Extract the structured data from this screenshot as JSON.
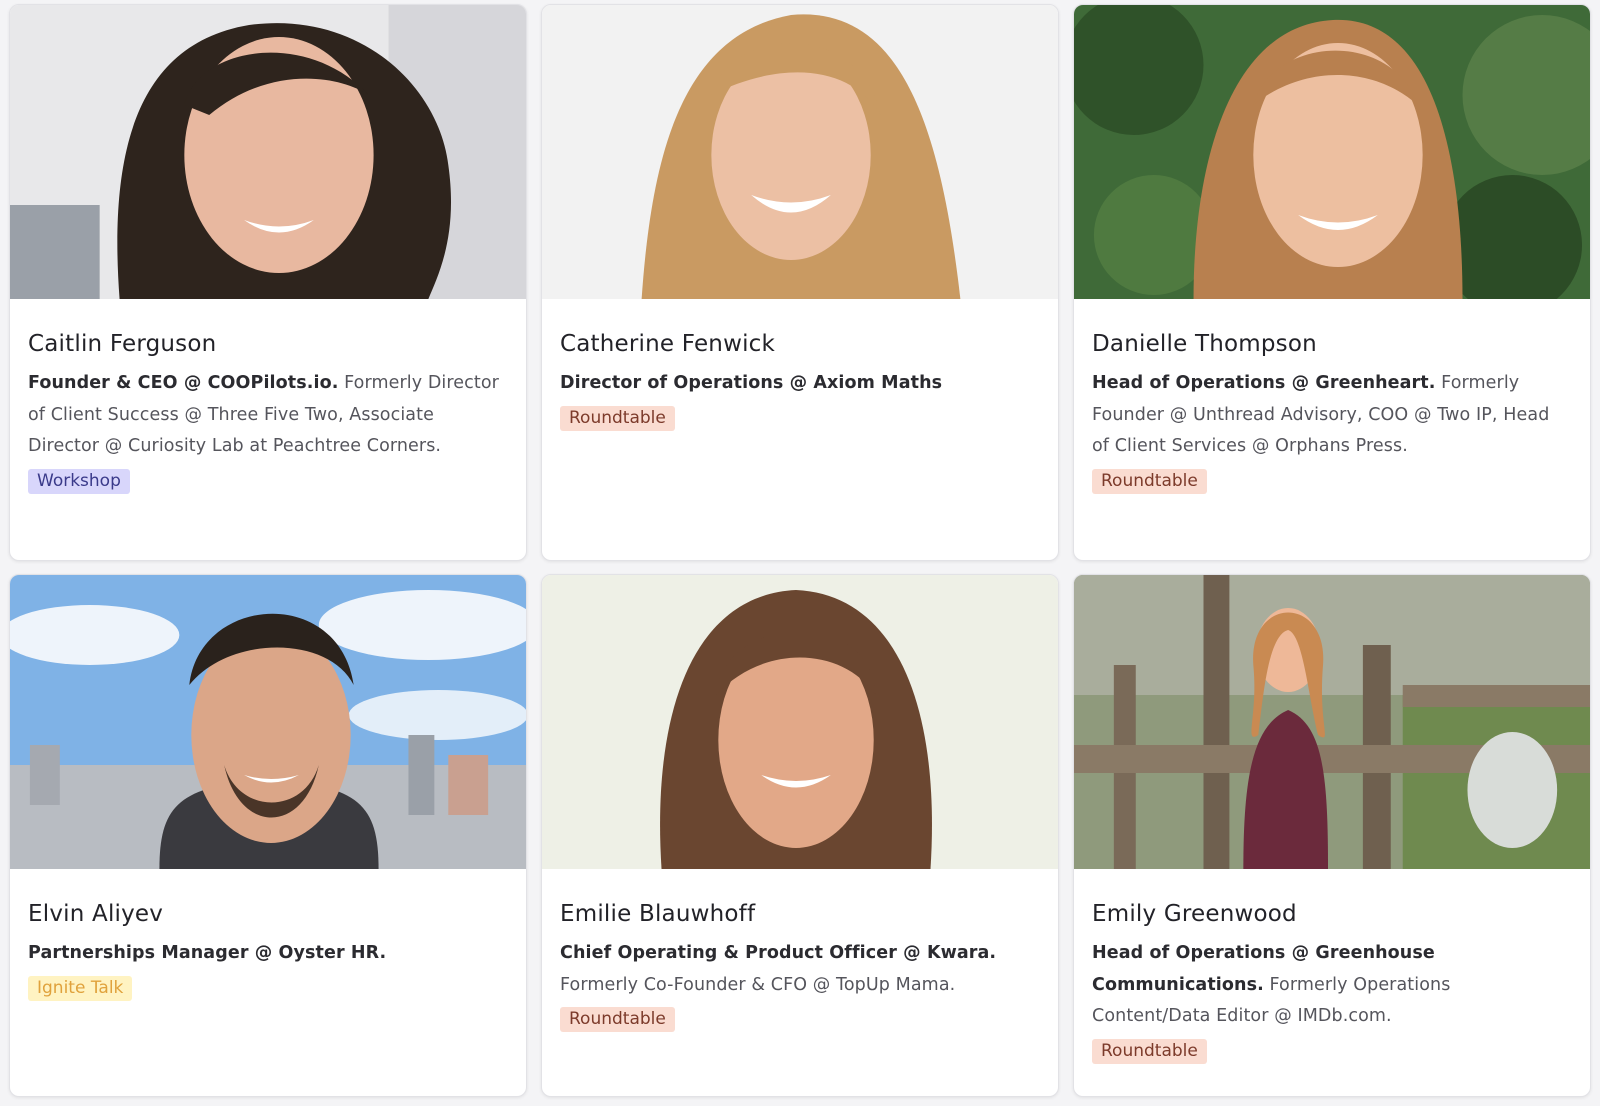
{
  "speakers": [
    {
      "name": "Caitlin Ferguson",
      "role": "Founder & CEO @ COOPilots.io.",
      "detail": " Formerly Director of Client Success @ Three Five Two, Associate Director @ Curiosity Lab at Peachtree Corners.",
      "tag": "Workshop"
    },
    {
      "name": "Catherine Fenwick",
      "role": "Director of Operations @ Axiom Maths",
      "detail": "",
      "tag": "Roundtable"
    },
    {
      "name": "Danielle Thompson",
      "role": "Head of Operations @ Greenheart.",
      "detail": " Formerly Founder @ Unthread Advisory, COO @ Two IP, Head of Client Services @ Orphans Press.",
      "tag": "Roundtable"
    },
    {
      "name": "Elvin Aliyev",
      "role": "Partnerships Manager @ Oyster HR.",
      "detail": "",
      "tag": "Ignite Talk"
    },
    {
      "name": "Emilie Blauwhoff",
      "role": "Chief Operating & Product Officer @ Kwara.",
      "detail": " Formerly Co-Founder & CFO @ TopUp Mama.",
      "tag": "Roundtable"
    },
    {
      "name": "Emily Greenwood",
      "role": "Head of Operations @ Greenhouse Communications.",
      "detail": " Formerly Operations Content/Data Editor @ IMDb.com.",
      "tag": "Roundtable"
    }
  ],
  "colors": {
    "workshop_bg": "#d8d6fb",
    "roundtable_bg": "#fadcd1",
    "ignite_bg": "#fff3c2"
  }
}
